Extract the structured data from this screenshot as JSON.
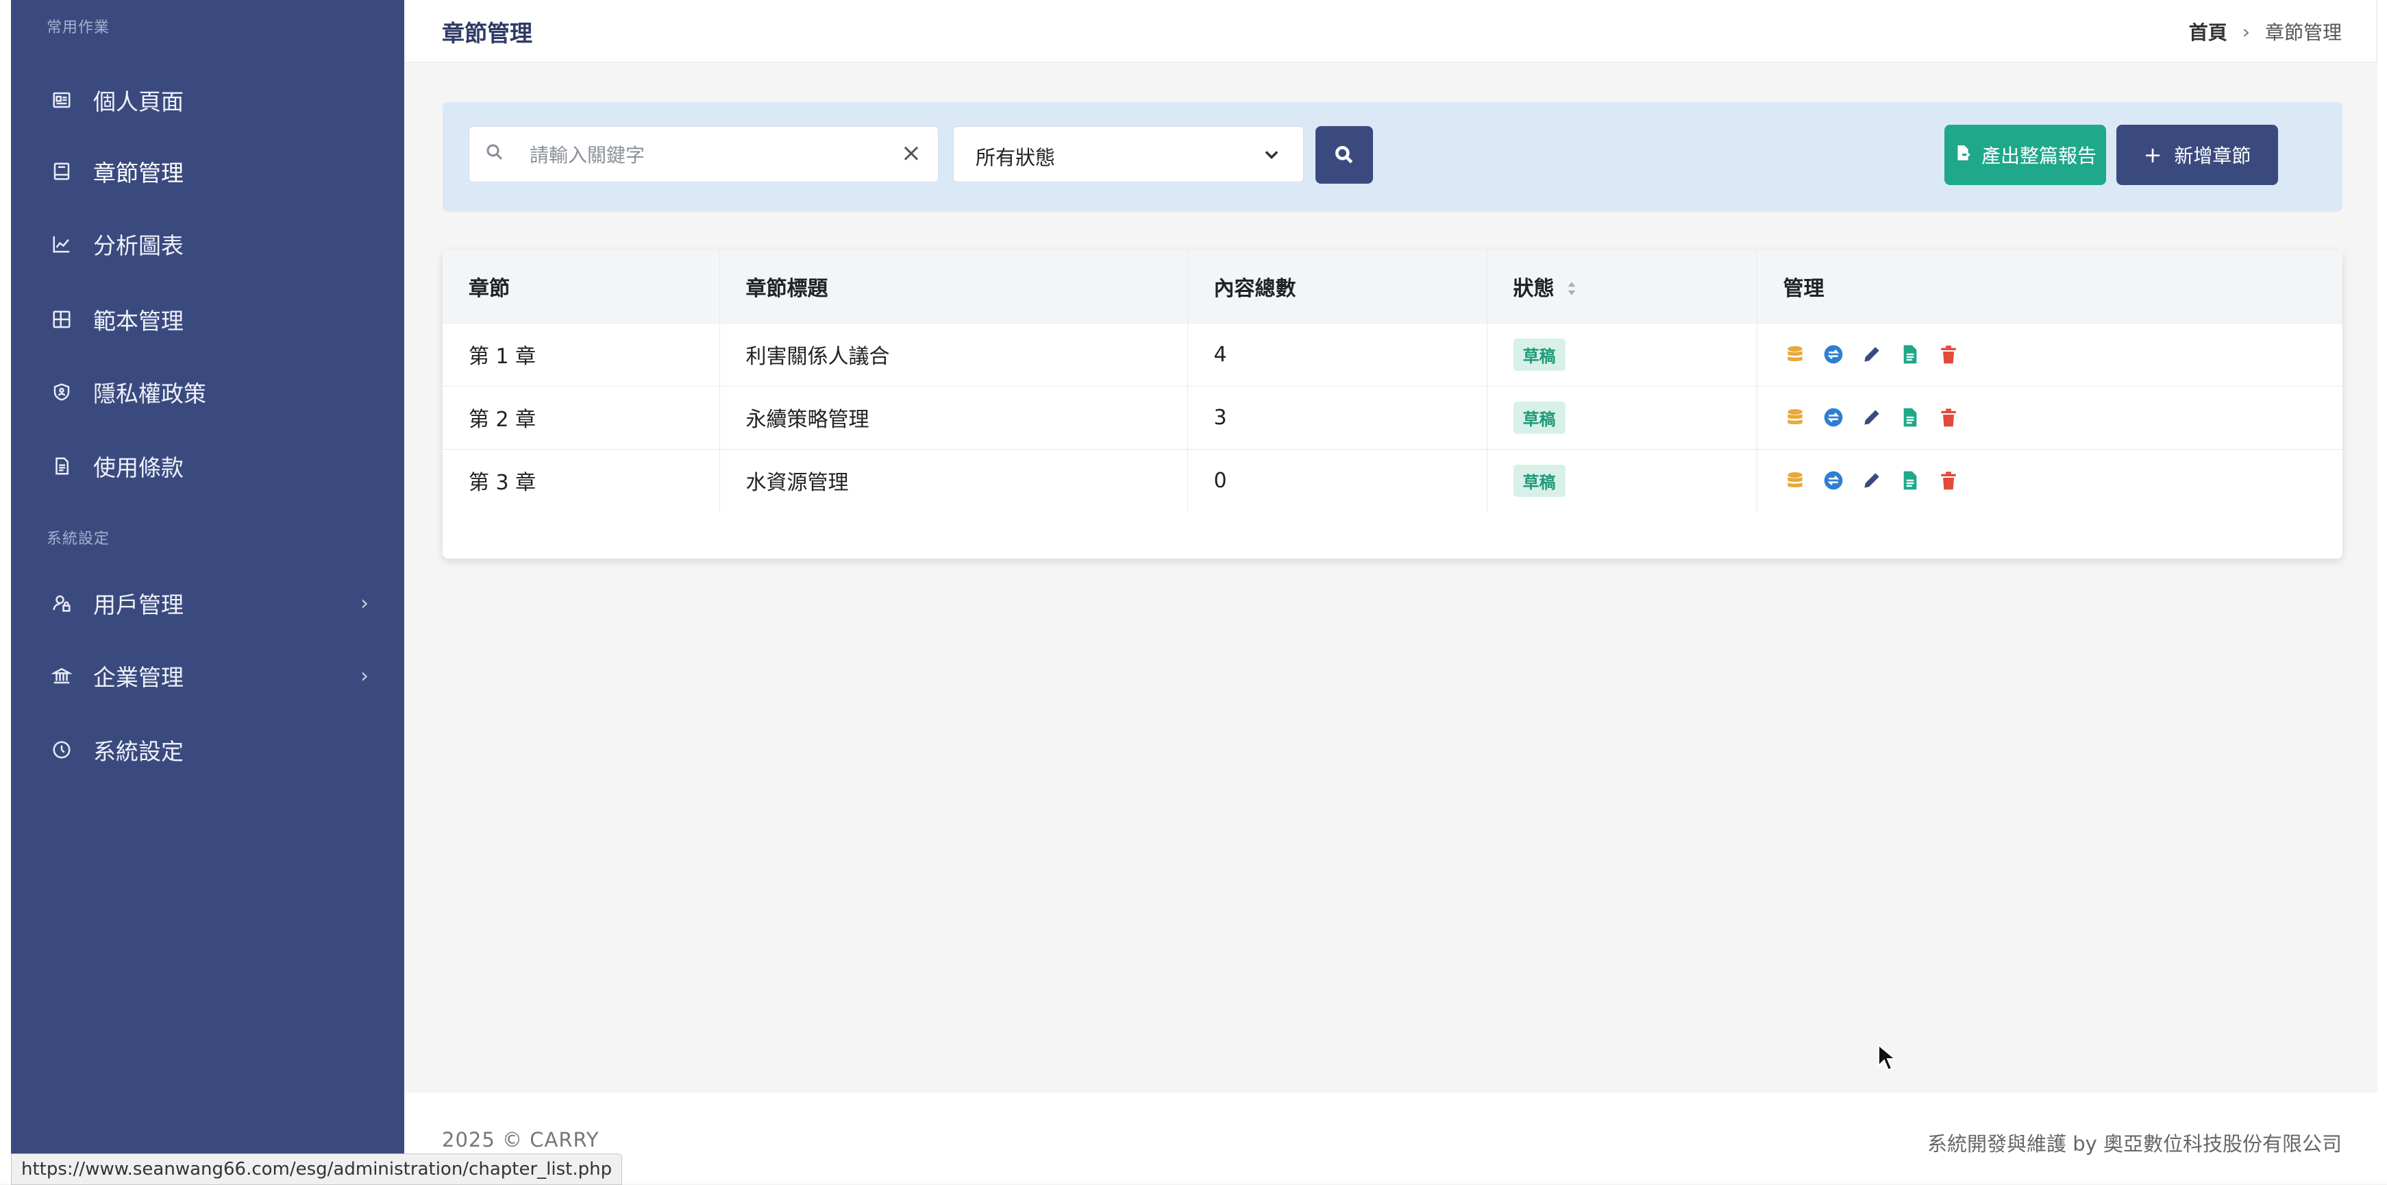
{
  "sidebar": {
    "section_common": "常用作業",
    "section_system": "系統設定",
    "items": [
      {
        "label": "個人頁面",
        "icon": "id-card-icon"
      },
      {
        "label": "章節管理",
        "icon": "book-icon",
        "active": true
      },
      {
        "label": "分析圖表",
        "icon": "chart-line-icon"
      },
      {
        "label": "範本管理",
        "icon": "template-icon"
      },
      {
        "label": "隱私權政策",
        "icon": "shield-icon"
      },
      {
        "label": "使用條款",
        "icon": "document-icon"
      },
      {
        "label": "用戶管理",
        "icon": "user-lock-icon",
        "has_submenu": true
      },
      {
        "label": "企業管理",
        "icon": "bank-icon",
        "has_submenu": true
      },
      {
        "label": "系統設定",
        "icon": "settings-icon"
      }
    ],
    "chevron": "›"
  },
  "header": {
    "title": "章節管理",
    "breadcrumb": {
      "home": "首頁",
      "separator": "›",
      "current": "章節管理"
    }
  },
  "filters": {
    "search_placeholder": "請輸入關鍵字",
    "search_value": "",
    "clear_label": "×",
    "status_selected": "所有狀態",
    "report_button": "產出整篇報告",
    "add_button": "新增章節",
    "add_button_icon": "+"
  },
  "table": {
    "columns": [
      "章節",
      "章節標題",
      "內容總數",
      "狀態",
      "管理"
    ],
    "rows": [
      {
        "chapter": "第 1 章",
        "title": "利害關係人議合",
        "count": "4",
        "status": "草稿"
      },
      {
        "chapter": "第 2 章",
        "title": "永續策略管理",
        "count": "3",
        "status": "草稿"
      },
      {
        "chapter": "第 3 章",
        "title": "水資源管理",
        "count": "0",
        "status": "草稿"
      }
    ],
    "row_actions": [
      "database-icon",
      "exchange-icon",
      "edit-icon",
      "file-icon",
      "trash-icon"
    ]
  },
  "footer": {
    "copyright": "2025 © CARRY",
    "credit": "系統開發與維護 by 奧亞數位科技股份有限公司"
  },
  "status_bar": {
    "url": "https://www.seanwang66.com/esg/administration/chapter_list.php"
  },
  "colors": {
    "sidebar_bg": "#3b4a7e",
    "primary": "#3b4a7e",
    "success": "#1fa88a",
    "filter_bg": "#dbe9f6",
    "badge_bg": "#d7f1e9",
    "badge_text": "#1f9a7a",
    "action_yellow": "#e8a93a",
    "action_blue": "#2f7fd0",
    "action_dark": "#3b4a7e",
    "action_green": "#1fa88a",
    "action_red": "#e24a3c"
  }
}
